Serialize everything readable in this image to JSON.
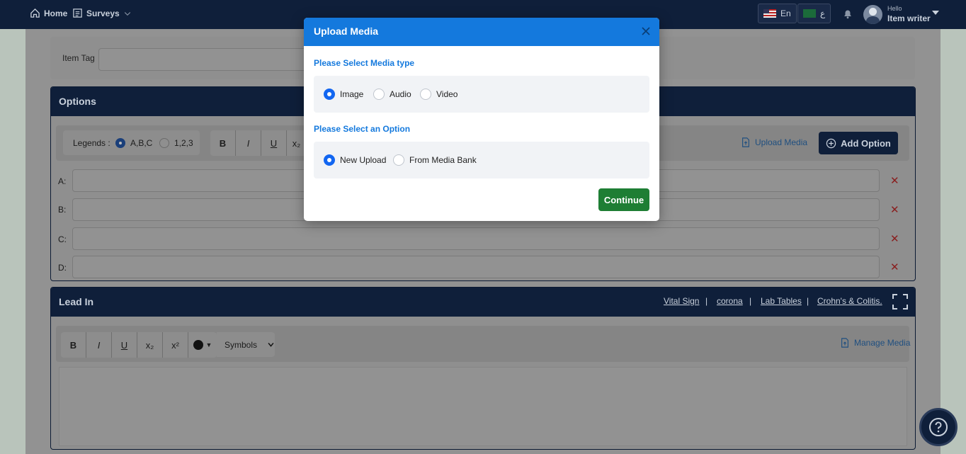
{
  "nav": {
    "home": "Home",
    "surveys": "Surveys",
    "lang_en": "En",
    "lang_ar": "ع",
    "hello": "Hello",
    "user": "Item writer"
  },
  "background": {
    "item_tag_label": "Item Tag",
    "options_title": "Options",
    "legends_label": "Legends :",
    "legend_abc": "A,B,C",
    "legend_123": "1,2,3",
    "upload_media": "Upload Media",
    "add_option": "Add Option",
    "rows": [
      "A:",
      "B:",
      "C:",
      "D:"
    ],
    "lead_in_title": "Lead In",
    "lead_links": [
      "Vital Sign",
      "corona",
      "Lab Tables",
      "Crohn's & Colitis."
    ],
    "symbols": "Symbols",
    "manage_media": "Manage Media",
    "format_bold": "B",
    "format_italic": "I",
    "format_underline": "U",
    "format_sub": "x₂",
    "format_sup": "x²"
  },
  "modal": {
    "title": "Upload Media",
    "media_type_label": "Please Select Media type",
    "media_types": [
      {
        "label": "Image",
        "selected": true
      },
      {
        "label": "Audio",
        "selected": false
      },
      {
        "label": "Video",
        "selected": false
      }
    ],
    "option_label": "Please Select an Option",
    "options": [
      {
        "label": "New Upload",
        "selected": true
      },
      {
        "label": "From Media Bank",
        "selected": false
      }
    ],
    "continue": "Continue"
  },
  "colors": {
    "navbar": "#0f1f3a",
    "modal_header": "#1479dd",
    "radio_selected": "#1266f1",
    "continue": "#1e7e34"
  }
}
